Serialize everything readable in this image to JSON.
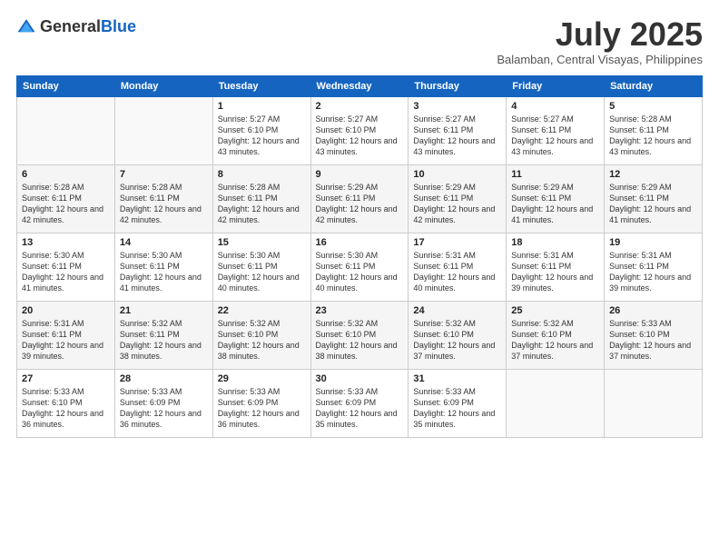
{
  "logo": {
    "text_general": "General",
    "text_blue": "Blue"
  },
  "header": {
    "month": "July 2025",
    "location": "Balamban, Central Visayas, Philippines"
  },
  "weekdays": [
    "Sunday",
    "Monday",
    "Tuesday",
    "Wednesday",
    "Thursday",
    "Friday",
    "Saturday"
  ],
  "weeks": [
    [
      {
        "day": "",
        "sunrise": "",
        "sunset": "",
        "daylight": ""
      },
      {
        "day": "",
        "sunrise": "",
        "sunset": "",
        "daylight": ""
      },
      {
        "day": "1",
        "sunrise": "Sunrise: 5:27 AM",
        "sunset": "Sunset: 6:10 PM",
        "daylight": "Daylight: 12 hours and 43 minutes."
      },
      {
        "day": "2",
        "sunrise": "Sunrise: 5:27 AM",
        "sunset": "Sunset: 6:10 PM",
        "daylight": "Daylight: 12 hours and 43 minutes."
      },
      {
        "day": "3",
        "sunrise": "Sunrise: 5:27 AM",
        "sunset": "Sunset: 6:11 PM",
        "daylight": "Daylight: 12 hours and 43 minutes."
      },
      {
        "day": "4",
        "sunrise": "Sunrise: 5:27 AM",
        "sunset": "Sunset: 6:11 PM",
        "daylight": "Daylight: 12 hours and 43 minutes."
      },
      {
        "day": "5",
        "sunrise": "Sunrise: 5:28 AM",
        "sunset": "Sunset: 6:11 PM",
        "daylight": "Daylight: 12 hours and 43 minutes."
      }
    ],
    [
      {
        "day": "6",
        "sunrise": "Sunrise: 5:28 AM",
        "sunset": "Sunset: 6:11 PM",
        "daylight": "Daylight: 12 hours and 42 minutes."
      },
      {
        "day": "7",
        "sunrise": "Sunrise: 5:28 AM",
        "sunset": "Sunset: 6:11 PM",
        "daylight": "Daylight: 12 hours and 42 minutes."
      },
      {
        "day": "8",
        "sunrise": "Sunrise: 5:28 AM",
        "sunset": "Sunset: 6:11 PM",
        "daylight": "Daylight: 12 hours and 42 minutes."
      },
      {
        "day": "9",
        "sunrise": "Sunrise: 5:29 AM",
        "sunset": "Sunset: 6:11 PM",
        "daylight": "Daylight: 12 hours and 42 minutes."
      },
      {
        "day": "10",
        "sunrise": "Sunrise: 5:29 AM",
        "sunset": "Sunset: 6:11 PM",
        "daylight": "Daylight: 12 hours and 42 minutes."
      },
      {
        "day": "11",
        "sunrise": "Sunrise: 5:29 AM",
        "sunset": "Sunset: 6:11 PM",
        "daylight": "Daylight: 12 hours and 41 minutes."
      },
      {
        "day": "12",
        "sunrise": "Sunrise: 5:29 AM",
        "sunset": "Sunset: 6:11 PM",
        "daylight": "Daylight: 12 hours and 41 minutes."
      }
    ],
    [
      {
        "day": "13",
        "sunrise": "Sunrise: 5:30 AM",
        "sunset": "Sunset: 6:11 PM",
        "daylight": "Daylight: 12 hours and 41 minutes."
      },
      {
        "day": "14",
        "sunrise": "Sunrise: 5:30 AM",
        "sunset": "Sunset: 6:11 PM",
        "daylight": "Daylight: 12 hours and 41 minutes."
      },
      {
        "day": "15",
        "sunrise": "Sunrise: 5:30 AM",
        "sunset": "Sunset: 6:11 PM",
        "daylight": "Daylight: 12 hours and 40 minutes."
      },
      {
        "day": "16",
        "sunrise": "Sunrise: 5:30 AM",
        "sunset": "Sunset: 6:11 PM",
        "daylight": "Daylight: 12 hours and 40 minutes."
      },
      {
        "day": "17",
        "sunrise": "Sunrise: 5:31 AM",
        "sunset": "Sunset: 6:11 PM",
        "daylight": "Daylight: 12 hours and 40 minutes."
      },
      {
        "day": "18",
        "sunrise": "Sunrise: 5:31 AM",
        "sunset": "Sunset: 6:11 PM",
        "daylight": "Daylight: 12 hours and 39 minutes."
      },
      {
        "day": "19",
        "sunrise": "Sunrise: 5:31 AM",
        "sunset": "Sunset: 6:11 PM",
        "daylight": "Daylight: 12 hours and 39 minutes."
      }
    ],
    [
      {
        "day": "20",
        "sunrise": "Sunrise: 5:31 AM",
        "sunset": "Sunset: 6:11 PM",
        "daylight": "Daylight: 12 hours and 39 minutes."
      },
      {
        "day": "21",
        "sunrise": "Sunrise: 5:32 AM",
        "sunset": "Sunset: 6:11 PM",
        "daylight": "Daylight: 12 hours and 38 minutes."
      },
      {
        "day": "22",
        "sunrise": "Sunrise: 5:32 AM",
        "sunset": "Sunset: 6:10 PM",
        "daylight": "Daylight: 12 hours and 38 minutes."
      },
      {
        "day": "23",
        "sunrise": "Sunrise: 5:32 AM",
        "sunset": "Sunset: 6:10 PM",
        "daylight": "Daylight: 12 hours and 38 minutes."
      },
      {
        "day": "24",
        "sunrise": "Sunrise: 5:32 AM",
        "sunset": "Sunset: 6:10 PM",
        "daylight": "Daylight: 12 hours and 37 minutes."
      },
      {
        "day": "25",
        "sunrise": "Sunrise: 5:32 AM",
        "sunset": "Sunset: 6:10 PM",
        "daylight": "Daylight: 12 hours and 37 minutes."
      },
      {
        "day": "26",
        "sunrise": "Sunrise: 5:33 AM",
        "sunset": "Sunset: 6:10 PM",
        "daylight": "Daylight: 12 hours and 37 minutes."
      }
    ],
    [
      {
        "day": "27",
        "sunrise": "Sunrise: 5:33 AM",
        "sunset": "Sunset: 6:10 PM",
        "daylight": "Daylight: 12 hours and 36 minutes."
      },
      {
        "day": "28",
        "sunrise": "Sunrise: 5:33 AM",
        "sunset": "Sunset: 6:09 PM",
        "daylight": "Daylight: 12 hours and 36 minutes."
      },
      {
        "day": "29",
        "sunrise": "Sunrise: 5:33 AM",
        "sunset": "Sunset: 6:09 PM",
        "daylight": "Daylight: 12 hours and 36 minutes."
      },
      {
        "day": "30",
        "sunrise": "Sunrise: 5:33 AM",
        "sunset": "Sunset: 6:09 PM",
        "daylight": "Daylight: 12 hours and 35 minutes."
      },
      {
        "day": "31",
        "sunrise": "Sunrise: 5:33 AM",
        "sunset": "Sunset: 6:09 PM",
        "daylight": "Daylight: 12 hours and 35 minutes."
      },
      {
        "day": "",
        "sunrise": "",
        "sunset": "",
        "daylight": ""
      },
      {
        "day": "",
        "sunrise": "",
        "sunset": "",
        "daylight": ""
      }
    ]
  ]
}
